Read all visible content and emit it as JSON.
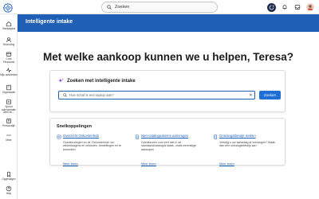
{
  "topbar": {
    "search_label": "Zoeken",
    "icons": [
      "home-icon",
      "search-icon",
      "chat-icon",
      "bell-icon",
      "help-icon",
      "avatar"
    ]
  },
  "nav": {
    "items": [
      {
        "label": "Startpagina",
        "icon": "home-icon"
      },
      {
        "label": "Recruiting",
        "icon": "recruiting-icon"
      },
      {
        "label": "Cora Financials",
        "icon": "finance-icon"
      },
      {
        "label": "Mijn activiteiten",
        "icon": "activity-icon"
      },
      {
        "label": "Organisatie",
        "icon": "organization-icon"
      },
      {
        "label": "Spend administratie werk en...",
        "icon": "spend-icon"
      },
      {
        "label": "Personalije",
        "icon": "person-icon"
      },
      {
        "label": "Meer",
        "icon": "more-icon"
      },
      {
        "label": "Opgeslagen",
        "icon": "bookmark-icon"
      },
      {
        "label": "Help",
        "icon": "help-icon"
      }
    ]
  },
  "header": {
    "title": "Intelligente intake"
  },
  "hero": {
    "title": "Met welke aankoop kunnen we u helpen, Teresa?"
  },
  "intake": {
    "title": "Zoeken met intelligente intake",
    "placeholder": "Hoe schaf ik een laptop aan?",
    "button": "Zoeken"
  },
  "shortcuts": {
    "title": "Snelkoppelingen",
    "items": [
      {
        "title": "Overzicht Onkostenhub",
        "description": "Goedkeuringen en de 'Onkostenhub' om winkelwagens en onkosten, bestellingen en te bewerken",
        "more": "Meer lezen"
      },
      {
        "title": "Niet-catalogusitems aanvragen",
        "description": "Goedkeuren voor een niet in de standaardcatalogus staan, zoals eenmalige aankopen",
        "more": "Meer lezen"
      },
      {
        "title": "Ontvangstbewijs maken",
        "description": "Verkrijg u uw aanvraag al ontvangen? Maak dan een ontvangstbewijs aan",
        "more": "Meer lezen"
      }
    ]
  },
  "colors": {
    "brand": "#1f5fb6",
    "button": "#1f6fd6",
    "topbar_active": "#1d2a4d"
  }
}
